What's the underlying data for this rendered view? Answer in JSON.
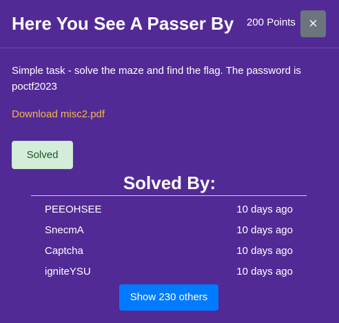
{
  "colors": {
    "background": "#522a96",
    "link": "#f5b942",
    "close_button": "#6c757d",
    "solved_bg": "#d4edda",
    "solved_text": "#155724",
    "primary": "#007bff"
  },
  "header": {
    "title": "Here You See A Passer By",
    "points": "200 Points",
    "close_label": "×"
  },
  "body": {
    "description": "Simple task - solve the maze and find the flag. The password is poctf2023",
    "download_label": "Download misc2.pdf",
    "solved_label": "Solved"
  },
  "solvers": {
    "heading": "Solved By:",
    "rows": [
      {
        "name": "PEEOHSEE",
        "time": "10 days ago"
      },
      {
        "name": "SnecmA",
        "time": "10 days ago"
      },
      {
        "name": "Captcha",
        "time": "10 days ago"
      },
      {
        "name": "igniteYSU",
        "time": "10 days ago"
      }
    ],
    "show_others_label": "Show 230 others"
  }
}
